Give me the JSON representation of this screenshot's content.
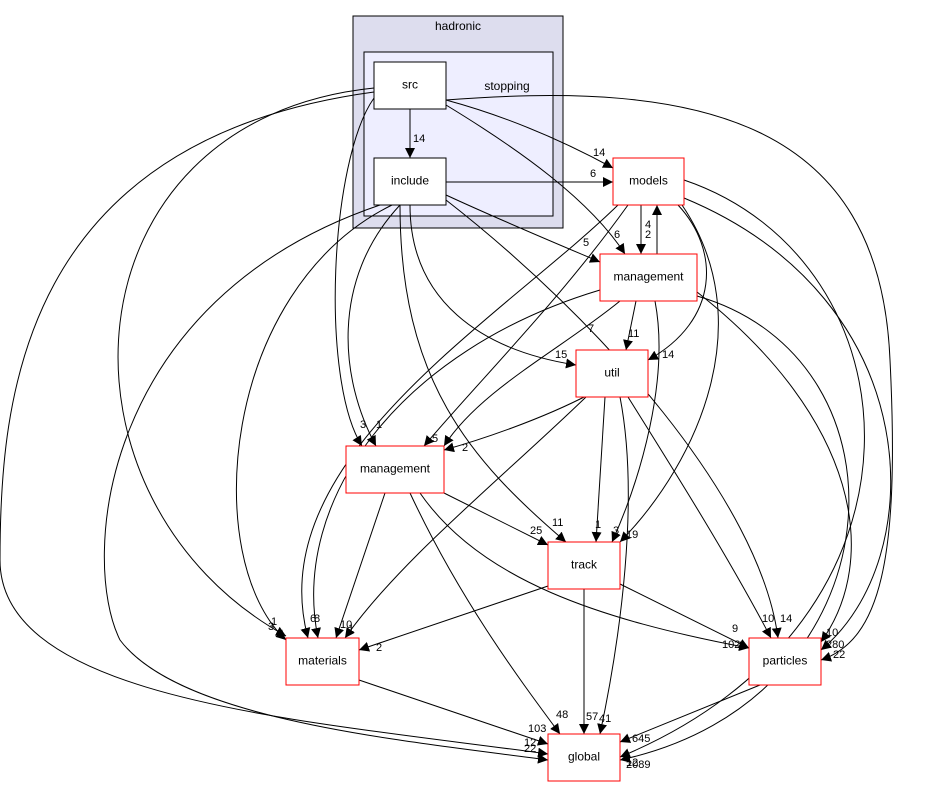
{
  "clusters": {
    "outer": "hadronic",
    "inner": "stopping"
  },
  "nodes": {
    "src": "src",
    "include": "include",
    "models": "models",
    "management_core": "management",
    "util": "util",
    "management": "management",
    "track": "track",
    "materials": "materials",
    "particles": "particles",
    "global": "global"
  },
  "colors": {
    "outer_cluster": "#ddddee",
    "inner_cluster": "#eeeeff",
    "external_node_border": "#ff0000"
  },
  "edges": [
    {
      "from": "src",
      "to": "include",
      "label": "14"
    },
    {
      "from": "src",
      "to": "models",
      "label": "14"
    },
    {
      "from": "include",
      "to": "models",
      "label": "6"
    },
    {
      "from": "include",
      "to": "management_core",
      "label": "5"
    },
    {
      "from": "src",
      "to": "management_core",
      "label": "6"
    },
    {
      "from": "models",
      "to": "management_core",
      "label": "2"
    },
    {
      "from": "management_core",
      "to": "models",
      "label": "4"
    },
    {
      "from": "management_core",
      "to": "util",
      "label": "11"
    },
    {
      "from": "include",
      "to": "util",
      "label": "15"
    },
    {
      "from": "models",
      "to": "util",
      "label": "14"
    },
    {
      "from": "management_core",
      "to": "management",
      "label": "7"
    },
    {
      "from": "util",
      "to": "management",
      "label": "2"
    },
    {
      "from": "models",
      "to": "management",
      "label": "5"
    },
    {
      "from": "include",
      "to": "management",
      "label": "1"
    },
    {
      "from": "src",
      "to": "management",
      "label": "3"
    },
    {
      "from": "management",
      "to": "track",
      "label": "25"
    },
    {
      "from": "include",
      "to": "track",
      "label": "11"
    },
    {
      "from": "util",
      "to": "track",
      "label": "1"
    },
    {
      "from": "management_core",
      "to": "track",
      "label": "3"
    },
    {
      "from": "models",
      "to": "track",
      "label": "19"
    },
    {
      "from": "src",
      "to": "materials",
      "label": "3"
    },
    {
      "from": "include",
      "to": "materials",
      "label": "1"
    },
    {
      "from": "models",
      "to": "materials",
      "label": "6"
    },
    {
      "from": "management_core",
      "to": "materials",
      "label": "8"
    },
    {
      "from": "management",
      "to": "materials",
      "label": "10"
    },
    {
      "from": "util",
      "to": "materials",
      "label": "1"
    },
    {
      "from": "track",
      "to": "materials",
      "label": "2"
    },
    {
      "from": "track",
      "to": "particles",
      "label": "9"
    },
    {
      "from": "management",
      "to": "particles",
      "label": "102"
    },
    {
      "from": "util",
      "to": "particles",
      "label": "10"
    },
    {
      "from": "include",
      "to": "particles",
      "label": "14"
    },
    {
      "from": "management_core",
      "to": "particles",
      "label": "10"
    },
    {
      "from": "models",
      "to": "particles",
      "label": "280"
    },
    {
      "from": "src",
      "to": "particles",
      "label": "22"
    },
    {
      "from": "materials",
      "to": "global",
      "label": "103"
    },
    {
      "from": "src",
      "to": "global",
      "label": "12"
    },
    {
      "from": "include",
      "to": "global",
      "label": "22"
    },
    {
      "from": "management",
      "to": "global",
      "label": "48"
    },
    {
      "from": "track",
      "to": "global",
      "label": "57"
    },
    {
      "from": "util",
      "to": "global",
      "label": "41"
    },
    {
      "from": "particles",
      "to": "global",
      "label": "645"
    },
    {
      "from": "models",
      "to": "global",
      "label": "12"
    },
    {
      "from": "management_core",
      "to": "global",
      "label": "2089"
    }
  ]
}
